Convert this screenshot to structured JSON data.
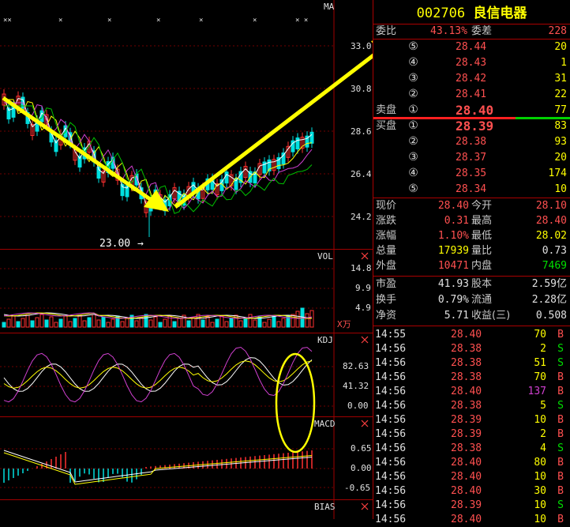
{
  "stock": {
    "code": "002706",
    "name": "良信电器"
  },
  "charts": {
    "ma_label": "MA",
    "price_ticks": [
      "33.0",
      "30.8",
      "28.6",
      "26.4",
      "24.2"
    ],
    "low_marker": "23.00",
    "vol_label": "VOL",
    "vol_ticks": [
      "14.8",
      "9.9",
      "4.9"
    ],
    "vol_unit": "X万",
    "kdj_label": "KDJ",
    "kdj_ticks": [
      "82.63",
      "41.32",
      "0.00"
    ],
    "macd_label": "MACD",
    "macd_ticks": [
      "0.65",
      "0.00",
      "-0.65"
    ],
    "bias_label": "BIAS",
    "top_markers": [
      "××",
      "×",
      "×",
      "×",
      "×",
      "×",
      "× ×"
    ],
    "colors": {
      "up": "#ff3030",
      "down": "#00e0e0",
      "annotation": "#ffff00",
      "grid": "#a00000"
    }
  },
  "chart_data": {
    "type": "candlestick",
    "price_axis": {
      "ylim": [
        23.0,
        33.8
      ]
    },
    "trend_annotations": [
      "down arrow from ~29.0 to ~24.2",
      "up arrow from ~24.5 to ~33.0"
    ],
    "kdj_highlight": "yellow ellipse around recent KDJ cross"
  },
  "quote": {
    "weibi_label": "委比",
    "weibi_value": "43.13%",
    "weicha_label": "委差",
    "weicha_value": "228",
    "sell_label": "卖盘",
    "buy_label": "买盘",
    "sells": [
      {
        "level": "⑤",
        "price": "28.44",
        "vol": "20"
      },
      {
        "level": "④",
        "price": "28.43",
        "vol": "1"
      },
      {
        "level": "③",
        "price": "28.42",
        "vol": "31"
      },
      {
        "level": "②",
        "price": "28.41",
        "vol": "22"
      },
      {
        "level": "①",
        "price": "28.40",
        "vol": "77"
      }
    ],
    "buys": [
      {
        "level": "①",
        "price": "28.39",
        "vol": "83"
      },
      {
        "level": "②",
        "price": "28.38",
        "vol": "93"
      },
      {
        "level": "③",
        "price": "28.37",
        "vol": "20"
      },
      {
        "level": "④",
        "price": "28.35",
        "vol": "174"
      },
      {
        "level": "⑤",
        "price": "28.34",
        "vol": "10"
      }
    ]
  },
  "stats": [
    {
      "l1": "现价",
      "v1": "28.40",
      "c1": "red",
      "l2": "今开",
      "v2": "28.10",
      "c2": "red"
    },
    {
      "l1": "涨跌",
      "v1": "0.31",
      "c1": "red",
      "l2": "最高",
      "v2": "28.40",
      "c2": "red"
    },
    {
      "l1": "涨幅",
      "v1": "1.10%",
      "c1": "red",
      "l2": "最低",
      "v2": "28.02",
      "c2": "yellow"
    },
    {
      "l1": "总量",
      "v1": "17939",
      "c1": "yellow",
      "l2": "量比",
      "v2": "0.73",
      "c2": "white"
    },
    {
      "l1": "外盘",
      "v1": "10471",
      "c1": "red",
      "l2": "内盘",
      "v2": "7469",
      "c2": "green"
    }
  ],
  "stats2": [
    {
      "l1": "市盈",
      "v1": "41.93",
      "l2": "股本",
      "v2": "2.59亿"
    },
    {
      "l1": "换手",
      "v1": "0.79%",
      "l2": "流通",
      "v2": "2.28亿"
    },
    {
      "l1": "净资",
      "v1": "5.71",
      "l2": "收益(三)",
      "v2": "0.508"
    }
  ],
  "ticks": [
    {
      "time": "14:55",
      "price": "28.40",
      "pc": "red",
      "vol": "70",
      "vc": "yellow",
      "side": "B"
    },
    {
      "time": "14:56",
      "price": "28.38",
      "pc": "red",
      "vol": "2",
      "vc": "yellow",
      "side": "S"
    },
    {
      "time": "14:56",
      "price": "28.38",
      "pc": "red",
      "vol": "51",
      "vc": "yellow",
      "side": "S"
    },
    {
      "time": "14:56",
      "price": "28.38",
      "pc": "red",
      "vol": "70",
      "vc": "yellow",
      "side": "B"
    },
    {
      "time": "14:56",
      "price": "28.40",
      "pc": "red",
      "vol": "137",
      "vc": "purple",
      "side": "B"
    },
    {
      "time": "14:56",
      "price": "28.38",
      "pc": "red",
      "vol": "5",
      "vc": "yellow",
      "side": "S"
    },
    {
      "time": "14:56",
      "price": "28.39",
      "pc": "red",
      "vol": "10",
      "vc": "yellow",
      "side": "B"
    },
    {
      "time": "14:56",
      "price": "28.39",
      "pc": "red",
      "vol": "2",
      "vc": "yellow",
      "side": "B"
    },
    {
      "time": "14:56",
      "price": "28.38",
      "pc": "red",
      "vol": "4",
      "vc": "yellow",
      "side": "S"
    },
    {
      "time": "14:56",
      "price": "28.40",
      "pc": "red",
      "vol": "80",
      "vc": "yellow",
      "side": "B"
    },
    {
      "time": "14:56",
      "price": "28.40",
      "pc": "red",
      "vol": "10",
      "vc": "yellow",
      "side": "B"
    },
    {
      "time": "14:56",
      "price": "28.40",
      "pc": "red",
      "vol": "30",
      "vc": "yellow",
      "side": "B"
    },
    {
      "time": "14:56",
      "price": "28.39",
      "pc": "red",
      "vol": "10",
      "vc": "yellow",
      "side": "S"
    },
    {
      "time": "14:56",
      "price": "28.40",
      "pc": "red",
      "vol": "10",
      "vc": "yellow",
      "side": "B"
    }
  ]
}
